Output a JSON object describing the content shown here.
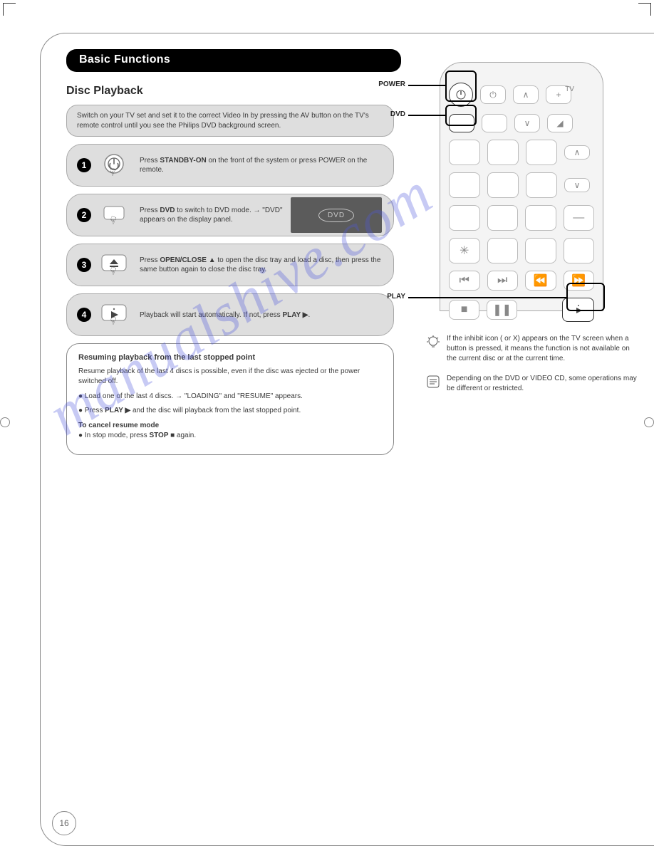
{
  "title_bar": "Basic Functions",
  "section_title": "Disc Playback",
  "intro": "Switch on your TV set and set it to the correct Video In by pressing the AV button on the TV's remote control until you see the Philips DVD background screen.",
  "steps": [
    {
      "num": "1",
      "text_prefix": "Press ",
      "bold": "STANDBY-ON",
      "text_suffix": " on the front of the system or press POWER on the remote.",
      "icon": "power"
    },
    {
      "num": "2",
      "text_prefix": "Press ",
      "bold": "DVD",
      "text_suffix": " to switch to DVD mode. → \"DVD\" appears on the display panel.",
      "icon": "button",
      "screen": true
    },
    {
      "num": "3",
      "text_prefix": "Press ",
      "bold": "OPEN/CLOSE ▲",
      "text_suffix": " to open the disc tray and load a disc, then press the same button again to close the disc tray.",
      "icon": "eject"
    },
    {
      "num": "4",
      "text_prefix": "Playback will start automatically. If not, press ",
      "bold": "PLAY ▶",
      "text_suffix": ".",
      "icon": "play"
    }
  ],
  "resume": {
    "title": "Resuming playback from the last stopped point",
    "p1": "Resume playback of the last 4 discs is possible, even if the disc was ejected or the power switched off.",
    "p2_a": "Load one of the last 4 discs. → \"",
    "p2_b": "LOADING",
    "p2_c": "\" and \"",
    "p2_d": "RESUME",
    "p2_e": "\" appears.",
    "p3_a": "Press ",
    "p3_b": "PLAY ▶",
    "p3_c": " and the disc will playback from the last stopped point.",
    "cancel_title": "To cancel resume mode",
    "cancel_a": "In stop mode, press ",
    "cancel_b": "STOP ■",
    "cancel_c": " again."
  },
  "tip1": "If the inhibit icon (   or X) appears on the TV screen when a button is pressed, it means the function is not available on the current disc or at the current time.",
  "tip2": "Depending on the DVD or VIDEO CD, some operations may be different or restricted.",
  "lead_labels": {
    "power": "POWER",
    "dvd": "DVD",
    "play": "PLAY"
  },
  "remote": {
    "tv": "TV",
    "dvd_label": "DVD"
  },
  "page_number": "16",
  "watermark": "manualshive.com"
}
